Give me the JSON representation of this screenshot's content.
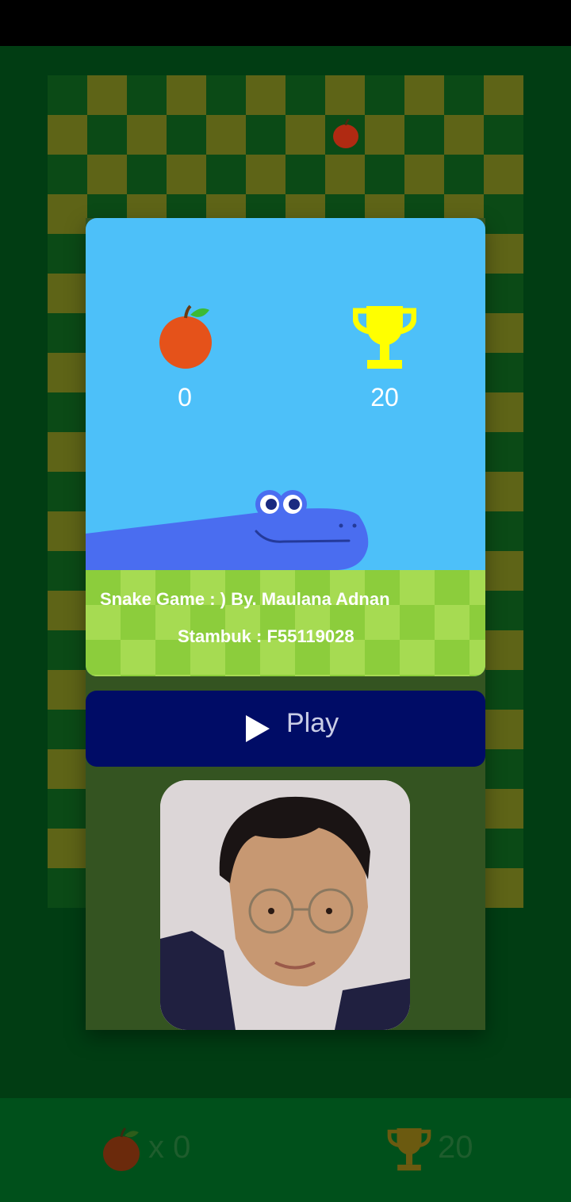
{
  "score": {
    "apples": "0",
    "best": "20"
  },
  "credits": {
    "line1": "Snake Game : ) By. Maulana Adnan",
    "line2": "Stambuk : F55119028"
  },
  "play_label": "Play",
  "bottom_bar": {
    "apple_count": "x 0",
    "trophy_count": "20"
  },
  "colors": {
    "sky": "#4dc0f9",
    "grass_dark": "#8ccd3c",
    "grass_light": "#a6db52",
    "snake": "#4a6df0",
    "play_button": "#000c66",
    "trophy": "#ffff00",
    "apple": "#e5521a"
  },
  "icons": [
    "apple-icon",
    "trophy-icon",
    "play-icon"
  ]
}
